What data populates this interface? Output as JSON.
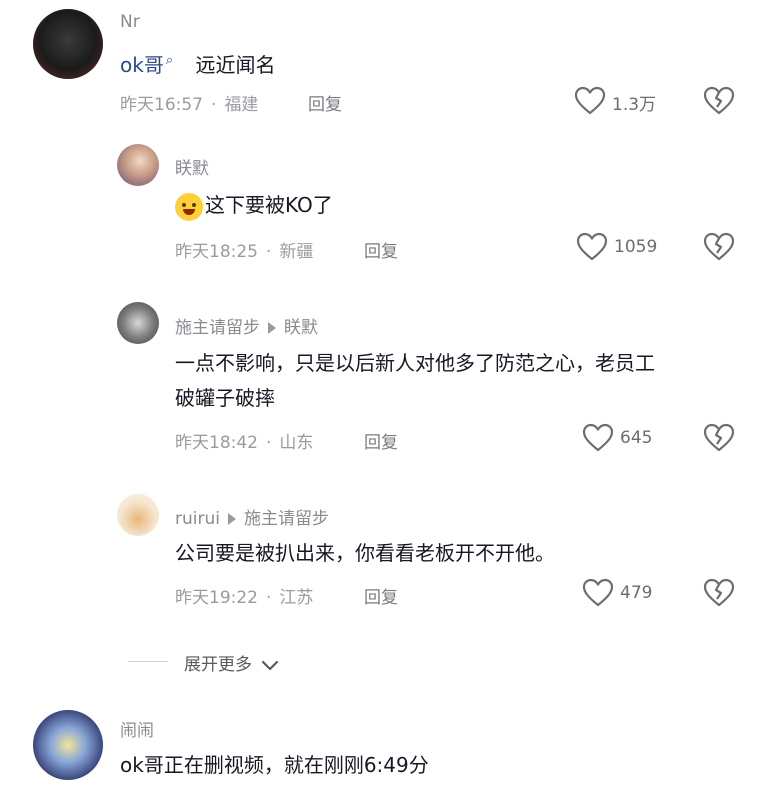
{
  "comments": [
    {
      "username": "Nr",
      "mention": "ok哥",
      "text": "远近闻名",
      "time": "昨天16:57",
      "location": "福建",
      "reply_label": "回复",
      "likes": "1.3万"
    }
  ],
  "replies": [
    {
      "username": "眹默",
      "text": "这下要被KO了",
      "emoji": "laugh-cry-emoji",
      "time": "昨天18:25",
      "location": "新疆",
      "reply_label": "回复",
      "likes": "1059"
    },
    {
      "username": "施主请留步",
      "reply_to": "眹默",
      "text_line1": "一点不影响，只是以后新人对他多了防范之心，老员工",
      "text_line2": "破罐子破摔",
      "time": "昨天18:42",
      "location": "山东",
      "reply_label": "回复",
      "likes": "645"
    },
    {
      "username": "ruirui",
      "reply_to": "施主请留步",
      "text": "公司要是被扒出来，你看看老板开不开他。",
      "time": "昨天19:22",
      "location": "江苏",
      "reply_label": "回复",
      "likes": "479"
    }
  ],
  "expand_more": "展开更多",
  "next_comment": {
    "username": "闹闹",
    "text": "ok哥正在删视频，就在刚刚6:49分"
  },
  "colors": {
    "text_primary": "#161823",
    "text_secondary": "#8a8b91",
    "mention": "#2b4a8a"
  }
}
